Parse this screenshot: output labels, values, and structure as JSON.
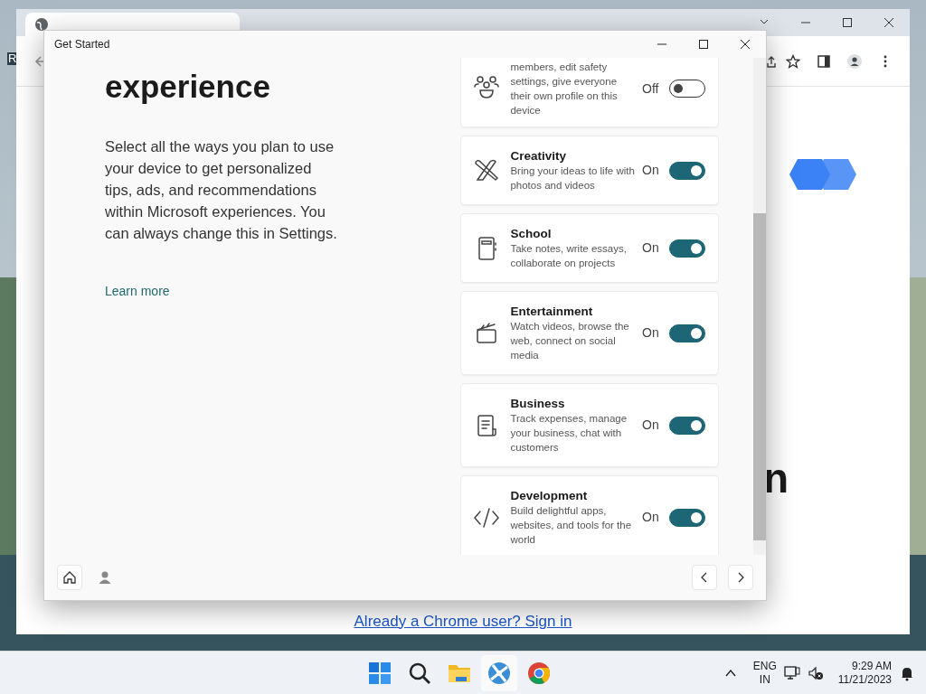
{
  "desktop": {
    "icon_label": "R"
  },
  "browser": {
    "heading_fragment": "n",
    "sign_in_link": "Already a Chrome user? Sign in"
  },
  "dialog": {
    "title": "Get Started",
    "heading": "experience",
    "body": "Select all the ways you plan to use your device to get personalized tips, ads, and recommendations within Microsoft experiences. You can always change this in Settings.",
    "learn_more": "Learn more",
    "categories": [
      {
        "kind": "family",
        "description": "members, edit safety settings, give everyone their own profile on this device",
        "status": "Off",
        "on": false
      },
      {
        "kind": "creativity",
        "title": "Creativity",
        "description": "Bring your ideas to life with photos and videos",
        "status": "On",
        "on": true
      },
      {
        "kind": "school",
        "title": "School",
        "description": "Take notes, write essays, collaborate on projects",
        "status": "On",
        "on": true
      },
      {
        "kind": "entertainment",
        "title": "Entertainment",
        "description": "Watch videos, browse the web, connect on social media",
        "status": "On",
        "on": true
      },
      {
        "kind": "business",
        "title": "Business",
        "description": "Track expenses, manage your business, chat with customers",
        "status": "On",
        "on": true
      },
      {
        "kind": "development",
        "title": "Development",
        "description": "Build delightful apps, websites, and tools for the world",
        "status": "On",
        "on": true
      }
    ]
  },
  "taskbar": {
    "language": "ENG",
    "region": "IN",
    "time": "9:29 AM",
    "date": "11/21/2023"
  }
}
